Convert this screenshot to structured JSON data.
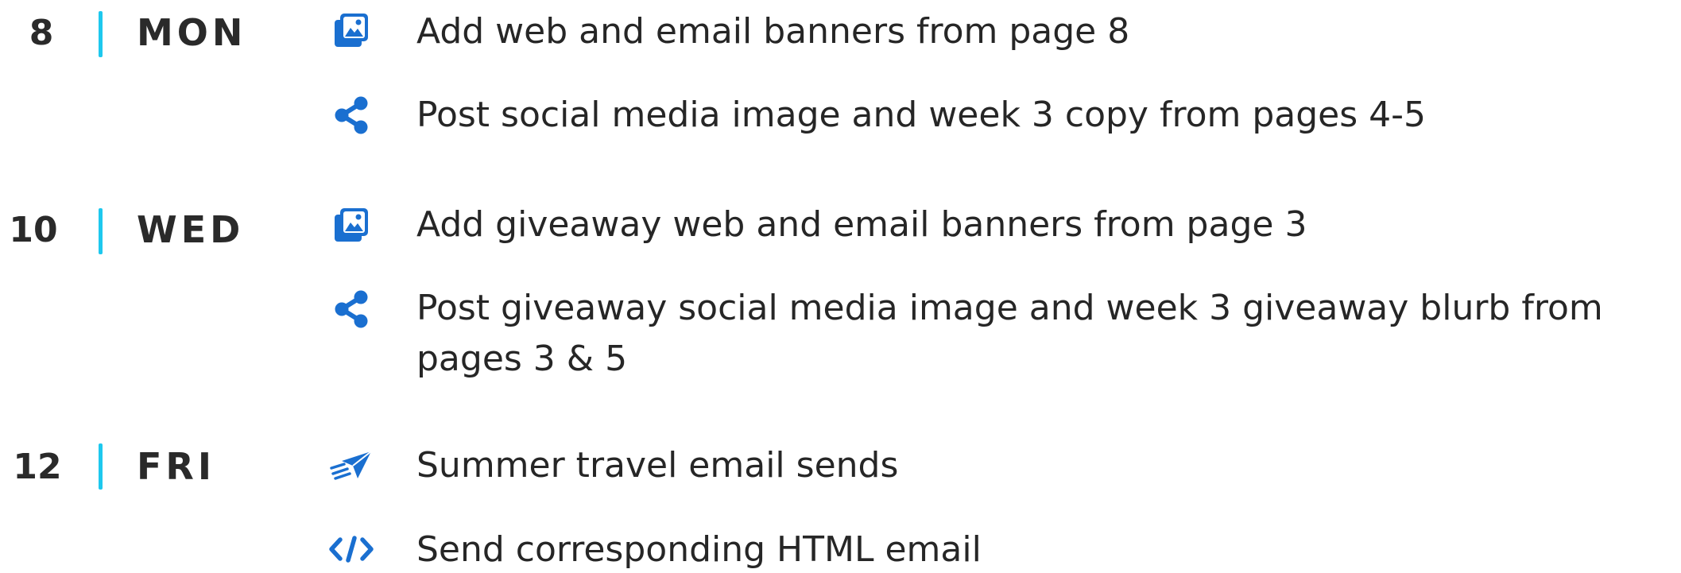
{
  "schedule": [
    {
      "day_number": "8",
      "day_name": "MON",
      "tasks": [
        {
          "icon": "image-gallery-icon",
          "text": "Add web and email banners from page 8"
        },
        {
          "icon": "share-icon",
          "text": "Post social media image and week 3 copy from pages 4-5"
        }
      ]
    },
    {
      "day_number": "10",
      "day_name": "WED",
      "tasks": [
        {
          "icon": "image-gallery-icon",
          "text": "Add giveaway web and email banners from page 3"
        },
        {
          "icon": "share-icon",
          "text": "Post giveaway social media image and week 3 giveaway blurb from pages 3 & 5"
        }
      ]
    },
    {
      "day_number": "12",
      "day_name": "FRI",
      "tasks": [
        {
          "icon": "send-icon",
          "text": "Summer travel email sends"
        },
        {
          "icon": "code-icon",
          "text": "Send corresponding HTML email"
        }
      ]
    }
  ],
  "colors": {
    "divider": "#1ec8ee",
    "icon": "#1a6fd0",
    "text": "#262626"
  }
}
